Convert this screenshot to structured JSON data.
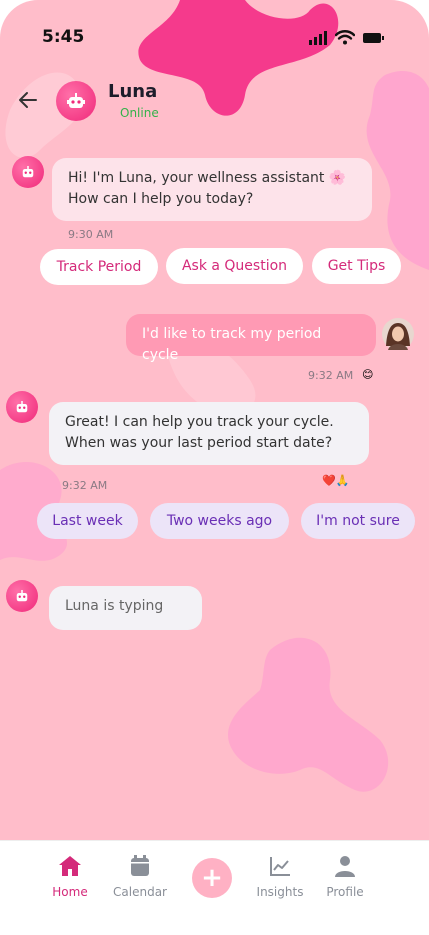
{
  "status_bar": {
    "time": "5:45"
  },
  "header": {
    "name": "Luna",
    "status": "Online"
  },
  "messages": [
    {
      "line1": "Hi! I'm Luna, your wellness assistant 🌸",
      "line2": "How can I help you today?",
      "time": "9:30 AM"
    },
    {
      "text": "I'd like to track my period cycle",
      "time": "9:32 AM",
      "reaction": "😊"
    },
    {
      "line1": "Great! I can help you track your cycle.",
      "line2": "When was your last period start date?",
      "time": "9:32 AM",
      "reactions": "❤️🙏"
    },
    {
      "text": "Luna is typing"
    }
  ],
  "quick_replies_1": [
    "Track Period",
    "Ask a Question",
    "Get Tips"
  ],
  "quick_replies_2": [
    "Last week",
    "Two weeks ago",
    "I'm not sure"
  ],
  "nav": {
    "items": [
      {
        "label": "Home",
        "icon": "home-icon"
      },
      {
        "label": "Calendar",
        "icon": "calendar-icon"
      },
      {
        "label": "Insights",
        "icon": "chart-icon"
      },
      {
        "label": "Profile",
        "icon": "person-icon"
      }
    ],
    "fab_icon": "plus-icon",
    "fab_label": "+"
  },
  "colors": {
    "accent": "#d42a7a",
    "background": "#ffbdca",
    "blob": "#f5358a"
  }
}
